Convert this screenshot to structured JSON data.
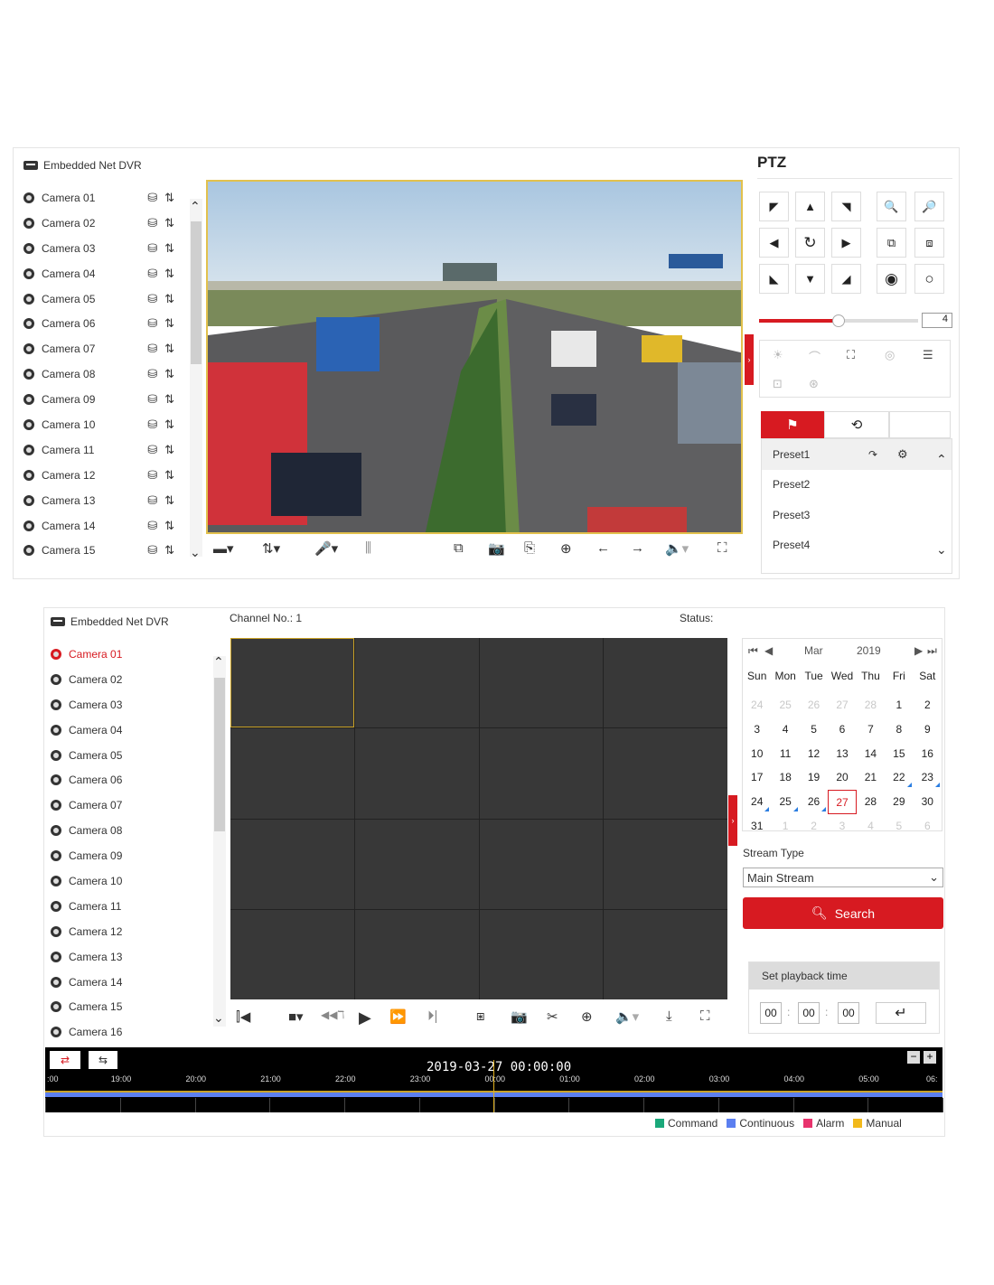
{
  "live": {
    "title": "Embedded Net DVR",
    "cameras": [
      "Camera 01",
      "Camera 02",
      "Camera 03",
      "Camera 04",
      "Camera 05",
      "Camera 06",
      "Camera 07",
      "Camera 08",
      "Camera 09",
      "Camera 10",
      "Camera 11",
      "Camera 12",
      "Camera 13",
      "Camera 14",
      "Camera 15"
    ],
    "ptz": {
      "title": "PTZ",
      "speed_value": "4",
      "presets": [
        "Preset1",
        "Preset2",
        "Preset3",
        "Preset4"
      ]
    }
  },
  "playback": {
    "title": "Embedded Net DVR",
    "channel_label": "Channel No.: 1",
    "status_label": "Status:",
    "cameras": [
      "Camera 01",
      "Camera 02",
      "Camera 03",
      "Camera 04",
      "Camera 05",
      "Camera 06",
      "Camera 07",
      "Camera 08",
      "Camera 09",
      "Camera 10",
      "Camera 11",
      "Camera 12",
      "Camera 13",
      "Camera 14",
      "Camera 15",
      "Camera 16"
    ],
    "calendar": {
      "month": "Mar",
      "year": "2019",
      "days_of_week": [
        "Sun",
        "Mon",
        "Tue",
        "Wed",
        "Thu",
        "Fri",
        "Sat"
      ],
      "selected_day": "27"
    },
    "stream_type_label": "Stream Type",
    "stream_type_value": "Main Stream",
    "search_label": "Search",
    "set_time_label": "Set playback time",
    "time": {
      "h": "00",
      "m": "00",
      "s": "00"
    },
    "timeline": {
      "datetime": "2019-03-27 00:00:00",
      "ticks": [
        ":00",
        "19:00",
        "20:00",
        "21:00",
        "22:00",
        "23:00",
        "00:00",
        "01:00",
        "02:00",
        "03:00",
        "04:00",
        "05:00",
        "06:"
      ]
    },
    "legend": [
      {
        "label": "Command",
        "color": "#1aa87a"
      },
      {
        "label": "Continuous",
        "color": "#5b7ff0"
      },
      {
        "label": "Alarm",
        "color": "#e8336d"
      },
      {
        "label": "Manual",
        "color": "#f2b91b"
      }
    ]
  }
}
